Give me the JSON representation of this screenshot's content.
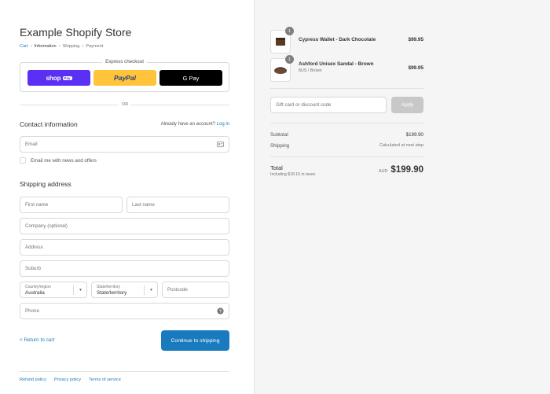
{
  "store": {
    "title": "Example Shopify Store"
  },
  "breadcrumb": {
    "cart": "Cart",
    "information": "Information",
    "shipping": "Shipping",
    "payment": "Payment"
  },
  "express": {
    "title": "Express checkout",
    "shop_pay": "shop",
    "shop_pay_badge": "Pay",
    "paypal": "PayPal",
    "gpay": "G Pay",
    "or": "OR"
  },
  "contact": {
    "title": "Contact information",
    "account_prompt": "Already have an account?",
    "login": "Log in",
    "email_placeholder": "Email",
    "newsletter": "Email me with news and offers"
  },
  "shipping": {
    "title": "Shipping address",
    "first_name": "First name",
    "last_name": "Last name",
    "company": "Company (optional)",
    "address": "Address",
    "suburb": "Suburb",
    "country_label": "Country/region",
    "country_value": "Australia",
    "state_label": "State/territory",
    "state_value": "State/territory",
    "postcode": "Postcode",
    "phone": "Phone"
  },
  "actions": {
    "return": "< Return to cart",
    "continue": "Continue to shipping"
  },
  "footer": {
    "refund": "Refund policy",
    "privacy": "Privacy policy",
    "terms": "Terms of service"
  },
  "order": {
    "items": [
      {
        "name": "Cypress Wallet - Dark Chocolate",
        "variant": "",
        "price": "$99.95",
        "qty": "1"
      },
      {
        "name": "Ashford Unisex Sandal - Brown",
        "variant": "8US / Brown",
        "price": "$99.95",
        "qty": "1"
      }
    ],
    "discount_placeholder": "Gift card or discount code",
    "apply": "Apply",
    "subtotal_label": "Subtotal",
    "subtotal_value": "$199.90",
    "shipping_label": "Shipping",
    "shipping_value": "Calculated at next step",
    "total_label": "Total",
    "taxes_note": "Including $18.16 in taxes",
    "currency": "AUD",
    "total_value": "$199.90"
  },
  "colors": {
    "accent": "#197bbd",
    "shop_pay": "#5a31f4",
    "paypal": "#ffc439"
  }
}
